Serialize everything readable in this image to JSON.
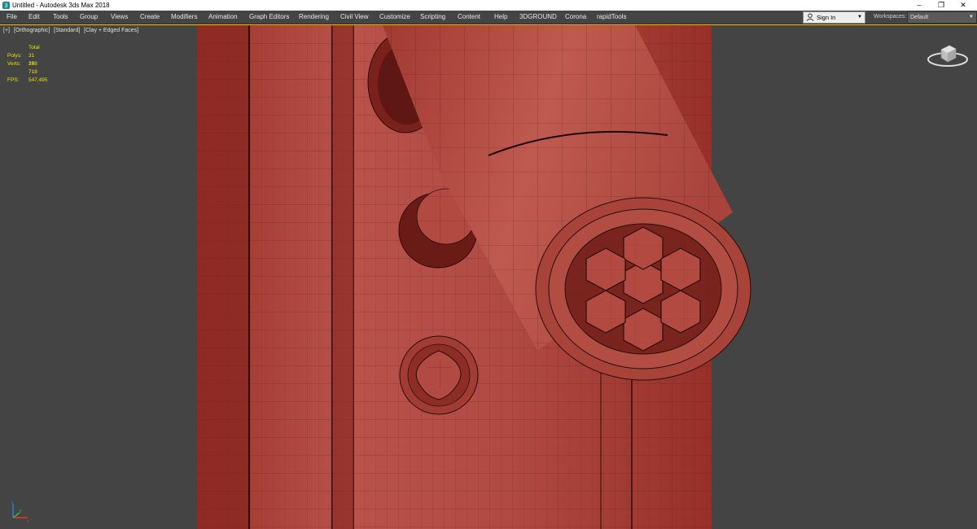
{
  "window": {
    "title": "Untitled - Autodesk 3ds Max 2018",
    "minimize_glyph": "–",
    "restore_glyph": "❐",
    "close_glyph": "✕"
  },
  "menu": [
    "File",
    "Edit",
    "Tools",
    "Group",
    "Views",
    "Create",
    "Modifiers",
    "Animation",
    "Graph Editors",
    "Rendering",
    "Civil View",
    "Customize",
    "Scripting",
    "Content",
    "Help",
    "3DGROUND",
    "Corona",
    "rapidTools"
  ],
  "signin": {
    "label": "Sign In",
    "icon": "user-icon"
  },
  "workspaces": {
    "label": "Workspaces:",
    "value": "Default"
  },
  "viewport": {
    "labels": [
      "[+]",
      "[Orthographic]",
      "[Standard]",
      "[Clay + Edged Faces]"
    ],
    "stats": {
      "header": "Total",
      "rows": [
        {
          "key": "Polys:",
          "value": "31 288"
        },
        {
          "key": "Verts:",
          "value": "15 718"
        }
      ],
      "fps_key": "FPS:",
      "fps_value": "547,495"
    },
    "colors": {
      "background": "#444444",
      "clay": "#b2473e",
      "wire": "#3a1412",
      "stats_text": "#f0e000"
    },
    "icons": [
      "viewcube-icon",
      "axis-tripod-icon"
    ]
  }
}
